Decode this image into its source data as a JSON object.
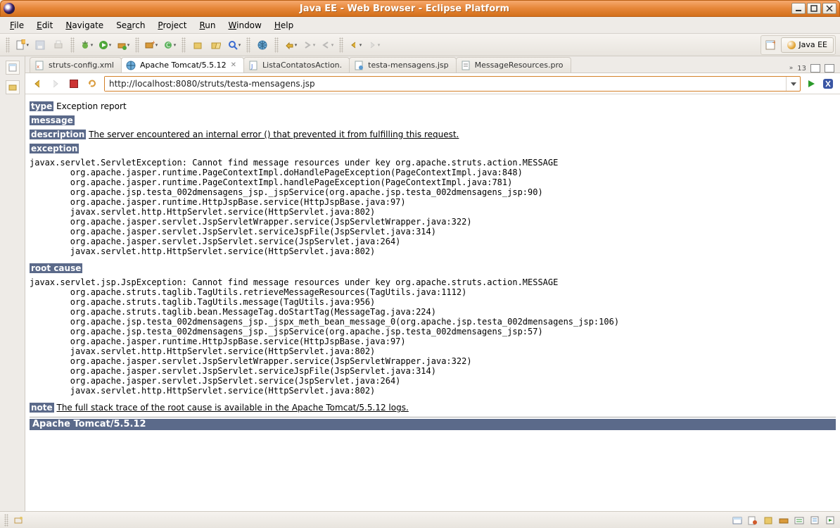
{
  "window": {
    "title": "Java EE - Web Browser - Eclipse Platform"
  },
  "menubar": {
    "items": [
      "File",
      "Edit",
      "Navigate",
      "Search",
      "Project",
      "Run",
      "Window",
      "Help"
    ]
  },
  "perspective": {
    "label": "Java EE"
  },
  "editor_tabs": {
    "overflow_count": "13",
    "items": [
      {
        "label": "struts-config.xml",
        "active": false,
        "icon": "xml"
      },
      {
        "label": "Apache Tomcat/5.5.12",
        "active": true,
        "icon": "globe",
        "closable": true
      },
      {
        "label": "ListaContatosAction.",
        "active": false,
        "icon": "java"
      },
      {
        "label": "testa-mensagens.jsp",
        "active": false,
        "icon": "jsp"
      },
      {
        "label": "MessageResources.pro",
        "active": false,
        "icon": "prop"
      }
    ]
  },
  "browser": {
    "url": "http://localhost:8080/struts/testa-mensagens.jsp"
  },
  "error_page": {
    "type_label": "type",
    "type_value": "Exception report",
    "message_label": "message",
    "description_label": "description",
    "description_value": "The server encountered an internal error () that prevented it from fulfilling this request.",
    "exception_label": "exception",
    "exception_trace": "javax.servlet.ServletException: Cannot find message resources under key org.apache.struts.action.MESSAGE\n\torg.apache.jasper.runtime.PageContextImpl.doHandlePageException(PageContextImpl.java:848)\n\torg.apache.jasper.runtime.PageContextImpl.handlePageException(PageContextImpl.java:781)\n\torg.apache.jsp.testa_002dmensagens_jsp._jspService(org.apache.jsp.testa_002dmensagens_jsp:90)\n\torg.apache.jasper.runtime.HttpJspBase.service(HttpJspBase.java:97)\n\tjavax.servlet.http.HttpServlet.service(HttpServlet.java:802)\n\torg.apache.jasper.servlet.JspServletWrapper.service(JspServletWrapper.java:322)\n\torg.apache.jasper.servlet.JspServlet.serviceJspFile(JspServlet.java:314)\n\torg.apache.jasper.servlet.JspServlet.service(JspServlet.java:264)\n\tjavax.servlet.http.HttpServlet.service(HttpServlet.java:802)",
    "root_cause_label": "root cause",
    "root_cause_trace": "javax.servlet.jsp.JspException: Cannot find message resources under key org.apache.struts.action.MESSAGE\n\torg.apache.struts.taglib.TagUtils.retrieveMessageResources(TagUtils.java:1112)\n\torg.apache.struts.taglib.TagUtils.message(TagUtils.java:956)\n\torg.apache.struts.taglib.bean.MessageTag.doStartTag(MessageTag.java:224)\n\torg.apache.jsp.testa_002dmensagens_jsp._jspx_meth_bean_message_0(org.apache.jsp.testa_002dmensagens_jsp:106)\n\torg.apache.jsp.testa_002dmensagens_jsp._jspService(org.apache.jsp.testa_002dmensagens_jsp:57)\n\torg.apache.jasper.runtime.HttpJspBase.service(HttpJspBase.java:97)\n\tjavax.servlet.http.HttpServlet.service(HttpServlet.java:802)\n\torg.apache.jasper.servlet.JspServletWrapper.service(JspServletWrapper.java:322)\n\torg.apache.jasper.servlet.JspServlet.serviceJspFile(JspServlet.java:314)\n\torg.apache.jasper.servlet.JspServlet.service(JspServlet.java:264)\n\tjavax.servlet.http.HttpServlet.service(HttpServlet.java:802)",
    "note_label": "note",
    "note_value": "The full stack trace of the root cause is available in the Apache Tomcat/5.5.12 logs.",
    "footer": "Apache Tomcat/5.5.12"
  }
}
